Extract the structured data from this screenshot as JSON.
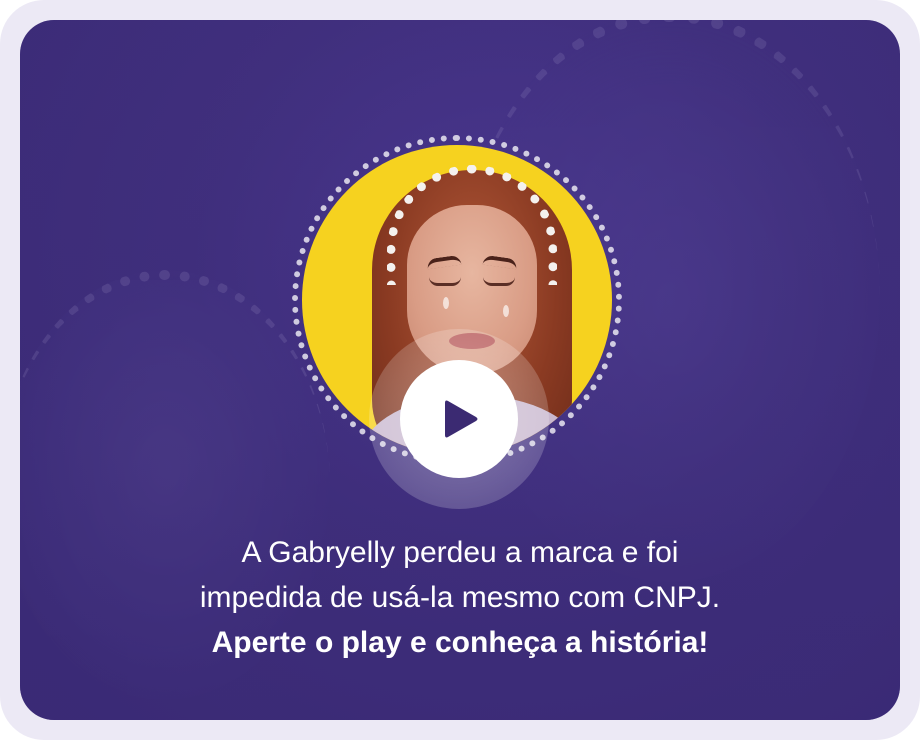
{
  "caption": {
    "line1": "A Gabryelly perdeu a marca e foi",
    "line2": "impedida de usá-la mesmo com CNPJ.",
    "line3": "Aperte o play e conheça a história!"
  },
  "icons": {
    "play": "play-icon"
  },
  "colors": {
    "card_background": "#41307f",
    "portrait_disc": "#f6d21f",
    "play_button": "#ffffff",
    "play_icon": "#3b2a72",
    "text": "#ffffff"
  }
}
